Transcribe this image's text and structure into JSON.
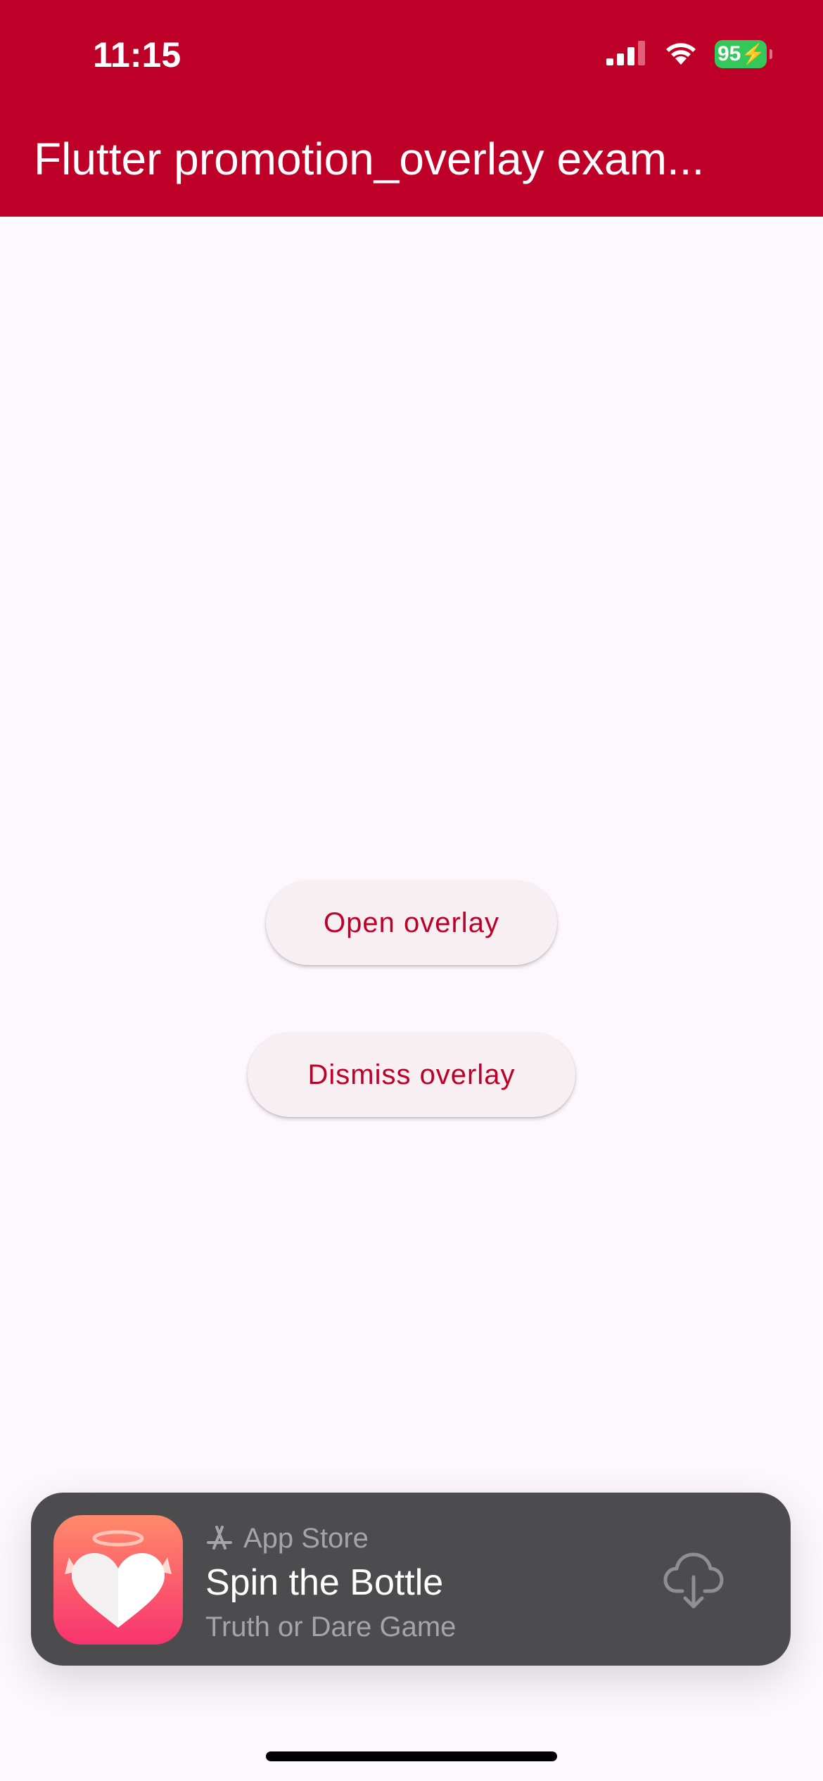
{
  "status_bar": {
    "time": "11:15",
    "battery_level": "95",
    "battery_charging": true,
    "signal_bars": 3,
    "battery_color": "#34c759",
    "icons": [
      "cellular-signal-icon",
      "wifi-icon",
      "battery-icon"
    ]
  },
  "app_bar": {
    "title": "Flutter promotion_overlay exam...",
    "background_color": "#be0028"
  },
  "main": {
    "open_button_label": "Open overlay",
    "dismiss_button_label": "Dismiss overlay",
    "accent_color": "#be0028"
  },
  "overlay": {
    "store_label": "App Store",
    "app_name": "Spin the Bottle",
    "app_subtitle": "Truth or Dare Game",
    "store_icon": "app-store-icon",
    "download_icon": "cloud-download-icon",
    "background_color": "#4c4c4e"
  }
}
